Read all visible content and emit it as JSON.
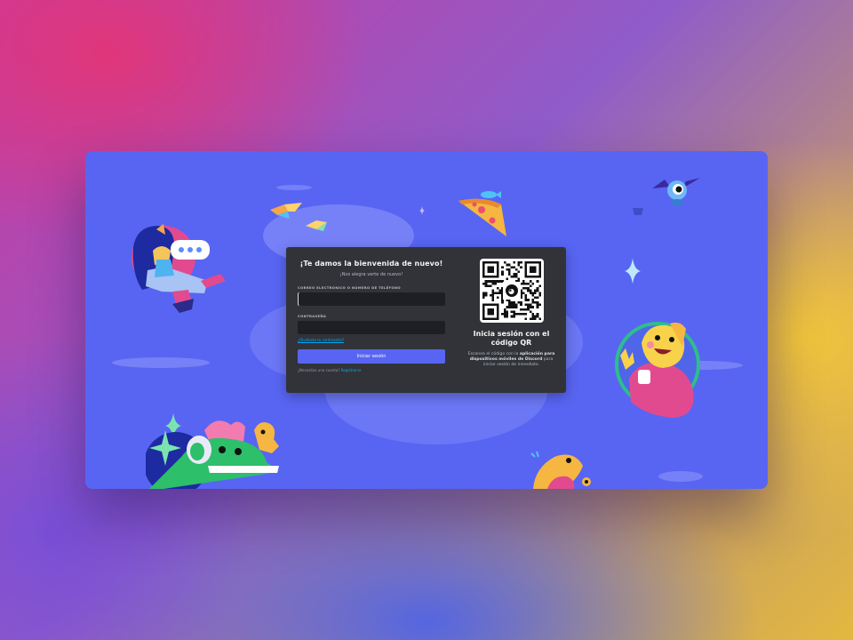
{
  "login": {
    "title": "¡Te damos la bienvenida de nuevo!",
    "subtitle": "¡Nos alegra verte de nuevo!",
    "email_label": "CORREO ELECTRÓNICO O NÚMERO DE TELÉFONO",
    "email_value": "",
    "password_label": "CONTRASEÑA",
    "password_value": "",
    "forgot_link": "¿Olvidaste tu contraseña?",
    "login_button": "Iniciar sesión",
    "register_prompt": "¿Necesitas una cuenta?",
    "register_link": "Registrarse"
  },
  "qr": {
    "title": "Inicia sesión con el código QR",
    "desc_1": "Escanea el código con la",
    "desc_bold_1": "aplicación para dispositivos móviles de Discord",
    "desc_2": "para iniciar sesión de inmediato."
  },
  "icons": {
    "qr_logo": "discord-logo-icon"
  },
  "colors": {
    "window_bg": "#5865f2",
    "card_bg": "#313338",
    "input_bg": "#1e1f22",
    "button_bg": "#5865f2",
    "link": "#00a8fc"
  }
}
